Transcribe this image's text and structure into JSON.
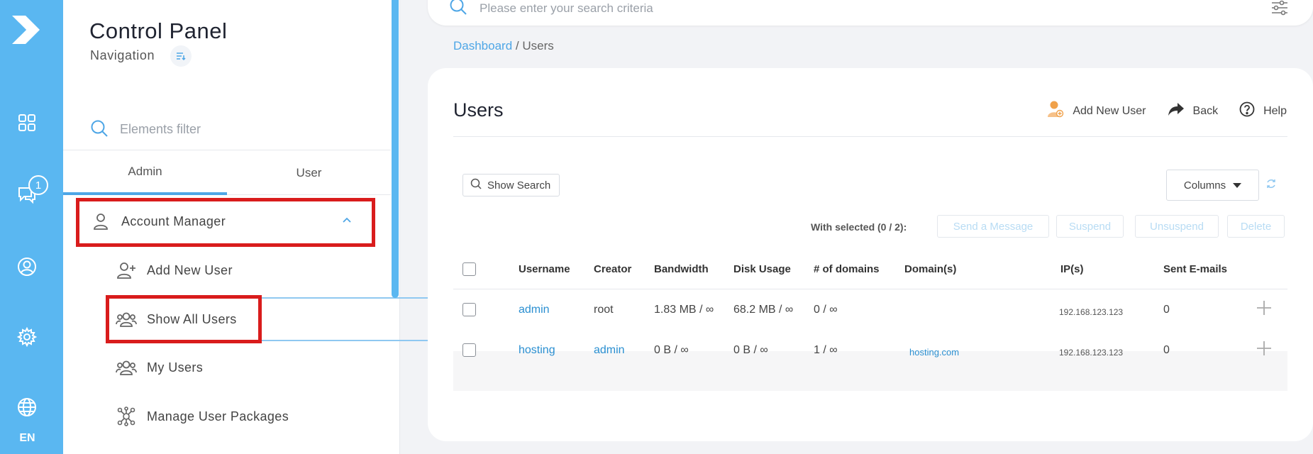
{
  "rail": {
    "lang": "EN",
    "messages_badge": "1"
  },
  "sidebar": {
    "title": "Control Panel",
    "subtitle": "Navigation",
    "filter_placeholder": "Elements filter",
    "tabs": [
      {
        "label": "Admin",
        "active": true
      },
      {
        "label": "User",
        "active": false
      }
    ],
    "section": "Account Manager",
    "items": [
      {
        "label": "Add New User"
      },
      {
        "label": "Show All Users"
      },
      {
        "label": "My Users"
      },
      {
        "label": "Manage User Packages"
      }
    ]
  },
  "topbar": {
    "search_placeholder": "Please enter your search criteria"
  },
  "breadcrumb": {
    "home": "Dashboard",
    "separator": "/",
    "current": "Users"
  },
  "main": {
    "title": "Users",
    "actions": {
      "add_user": "Add New User",
      "back": "Back",
      "help": "Help"
    },
    "show_search": "Show Search",
    "columns": "Columns",
    "with_selected": "With selected (0 / 2):",
    "bulk": {
      "send_message": "Send a Message",
      "suspend": "Suspend",
      "unsuspend": "Unsuspend",
      "delete": "Delete"
    },
    "table": {
      "headers": [
        "Username",
        "Creator",
        "Bandwidth",
        "Disk Usage",
        "# of domains",
        "Domain(s)",
        "IP(s)",
        "Sent E-mails"
      ],
      "rows": [
        {
          "username": "admin",
          "creator": "root",
          "bandwidth": "1.83 MB / ∞",
          "disk": "68.2 MB / ∞",
          "domains": "0 / ∞",
          "domain_list": "",
          "ip": "192.168.123.123",
          "sent": "0"
        },
        {
          "username": "hosting",
          "creator": "admin",
          "bandwidth": "0 B / ∞",
          "disk": "0 B / ∞",
          "domains": "1 / ∞",
          "domain_list": "hosting.com",
          "ip": "192.168.123.123",
          "sent": "0"
        }
      ]
    }
  },
  "colors": {
    "rail": "#5ab7f1",
    "accent": "#4ea6e6",
    "highlight": "#d91c1c",
    "link": "#2a8fd1"
  }
}
